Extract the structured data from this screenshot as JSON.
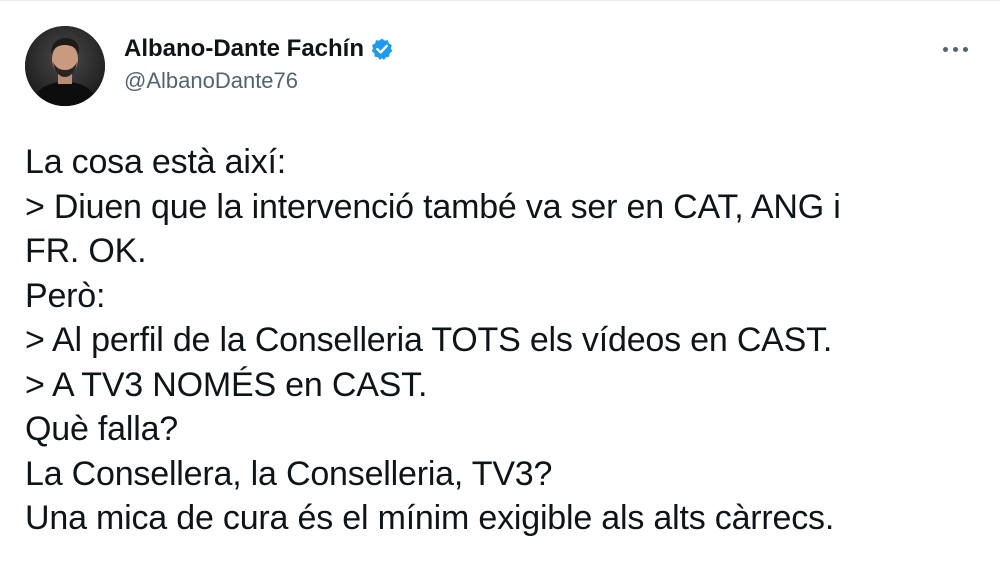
{
  "author": {
    "display_name": "Albano-Dante Fachín",
    "handle": "@AlbanoDante76",
    "verified": true,
    "avatar_icon": "person-avatar",
    "verified_icon": "verified-badge-icon"
  },
  "menu": {
    "icon": "more-horizontal-icon"
  },
  "tweet": {
    "lines": [
      "La cosa està així:",
      "> Diuen que la intervenció també va ser en CAT, ANG i",
      "FR. OK.",
      "Però:",
      "> Al perfil de la Conselleria TOTS els vídeos en CAST.",
      "> A TV3 NOMÉS en CAST.",
      "Què falla?",
      "La Consellera, la Conselleria, TV3?",
      "Una mica de cura és el mínim exigible als alts càrrecs."
    ]
  },
  "colors": {
    "text": "#0f1419",
    "secondary_text": "#536471",
    "verified_blue": "#1d9bf0",
    "border": "#e6ecf0"
  }
}
